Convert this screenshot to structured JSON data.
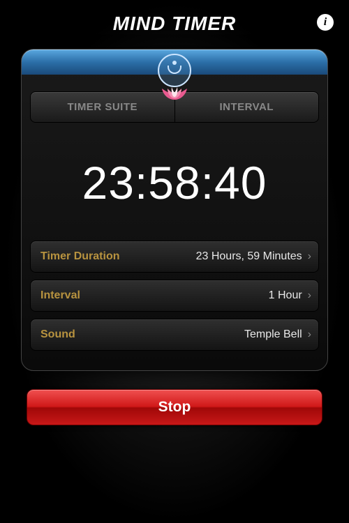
{
  "header": {
    "title": "MIND TIMER",
    "info_icon": "i"
  },
  "tabs": {
    "left": "TIMER SUITE",
    "right": "INTERVAL"
  },
  "time": "23:58:40",
  "settings": {
    "duration": {
      "label": "Timer Duration",
      "value": "23 Hours, 59 Minutes"
    },
    "interval": {
      "label": "Interval",
      "value": "1 Hour"
    },
    "sound": {
      "label": "Sound",
      "value": "Temple Bell"
    }
  },
  "buttons": {
    "stop": "Stop"
  },
  "colors": {
    "accent_gold": "#b8933f",
    "stop_red": "#d01818",
    "header_blue": "#2c6fa8"
  }
}
